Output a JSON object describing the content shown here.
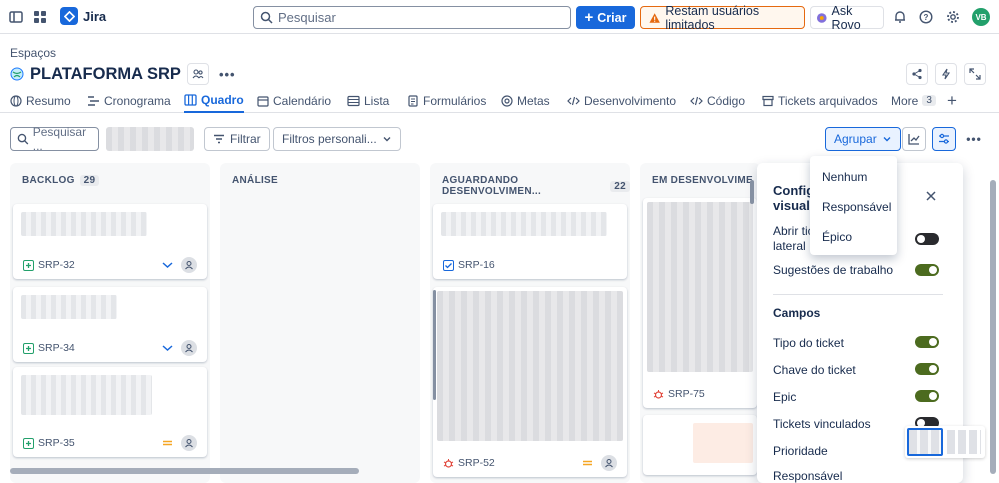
{
  "topbar": {
    "app_name": "Jira",
    "search_placeholder": "Pesquisar",
    "create_label": "Criar",
    "warning_label": "Restam usuários limitados",
    "rovo_label": "Ask Rovo",
    "avatar_initials": "VB"
  },
  "breadcrumb": "Espaços",
  "project": {
    "name": "PLATAFORMA SRP"
  },
  "tabs": [
    {
      "label": "Resumo"
    },
    {
      "label": "Cronograma"
    },
    {
      "label": "Quadro"
    },
    {
      "label": "Calendário"
    },
    {
      "label": "Lista"
    },
    {
      "label": "Formulários"
    },
    {
      "label": "Metas"
    },
    {
      "label": "Desenvolvimento"
    },
    {
      "label": "Código"
    },
    {
      "label": "Tickets arquivados"
    },
    {
      "label": "More"
    }
  ],
  "more_count": "3",
  "toolbar": {
    "search_placeholder": "Pesquisar ...",
    "filter_label": "Filtrar",
    "custom_filters_label": "Filtros personali...",
    "group_label": "Agrupar"
  },
  "columns": [
    {
      "title": "BACKLOG",
      "count": "29"
    },
    {
      "title": "ANÁLISE",
      "count": ""
    },
    {
      "title": "AGUARDANDO DESENVOLVIMEN...",
      "count": "22"
    },
    {
      "title": "EM DESENVOLVIME",
      "count": ""
    }
  ],
  "cards": {
    "srp32": "SRP-32",
    "srp34": "SRP-34",
    "srp35": "SRP-35",
    "srp16": "SRP-16",
    "srp52": "SRP-52",
    "srp75": "SRP-75"
  },
  "group_menu": {
    "items": [
      "Nenhum",
      "Responsável",
      "Épico"
    ]
  },
  "settings_panel": {
    "title_line1": "Config",
    "title_line2": "visuali",
    "open_ticket_line1": "Abrir tic",
    "open_ticket_line2": "lateral",
    "work_suggestions": "Sugestões de trabalho",
    "fields_heading": "Campos",
    "field_type": "Tipo do ticket",
    "field_key": "Chave do ticket",
    "field_epic": "Epic",
    "field_linked": "Tickets vinculados",
    "field_priority": "Prioridade",
    "field_cut": "Responsável"
  },
  "colors": {
    "primary": "#1868db",
    "warning_border": "#e56910",
    "toggle_on": "#4c6b1f",
    "bug_red": "#e2483d",
    "story_green": "#22a06b",
    "task_blue": "#1868db",
    "priority_orange": "#f5a623"
  }
}
